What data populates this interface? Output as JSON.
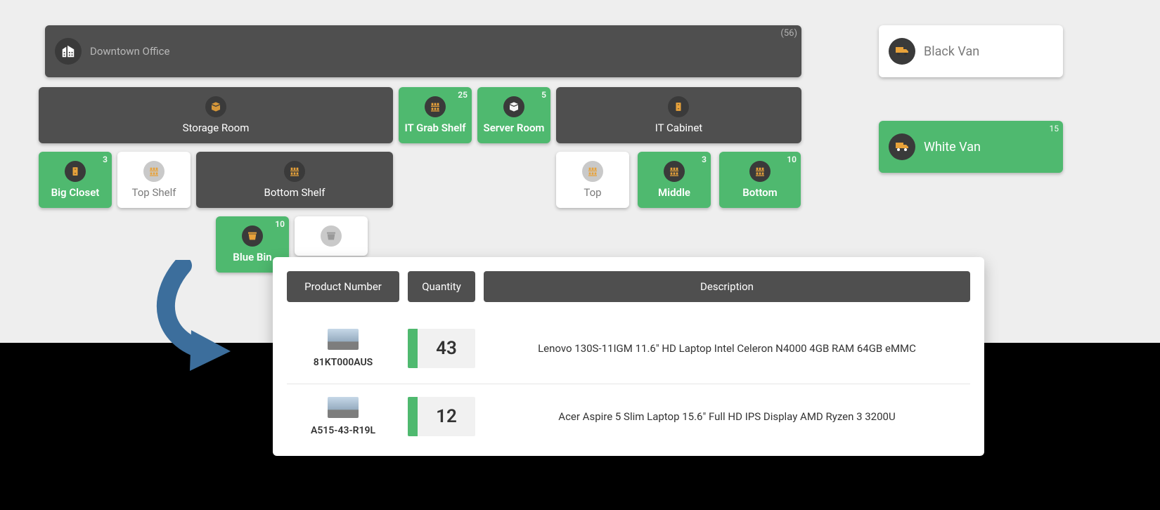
{
  "root_location": {
    "name": "Downtown Office",
    "count": "(56)"
  },
  "vehicles": {
    "black_van": {
      "name": "Black Van"
    },
    "white_van": {
      "name": "White Van",
      "count": "15"
    }
  },
  "rooms": {
    "storage_room": {
      "name": "Storage Room"
    },
    "it_grab_shelf": {
      "name": "IT Grab Shelf",
      "count": "25"
    },
    "server_room": {
      "name": "Server Room",
      "count": "5"
    },
    "it_cabinet": {
      "name": "IT Cabinet"
    }
  },
  "shelves": {
    "big_closet": {
      "name": "Big Closet",
      "count": "3"
    },
    "top_shelf": {
      "name": "Top Shelf"
    },
    "bottom_shelf": {
      "name": "Bottom Shelf"
    },
    "top": {
      "name": "Top"
    },
    "middle": {
      "name": "Middle",
      "count": "3"
    },
    "bottom": {
      "name": "Bottom",
      "count": "10"
    }
  },
  "bins": {
    "blue_bin": {
      "name": "Blue Bin",
      "count": "10"
    }
  },
  "table": {
    "columns": {
      "product_number": "Product Number",
      "quantity": "Quantity",
      "description": "Description"
    },
    "rows": [
      {
        "product_number": "81KT000AUS",
        "quantity": "43",
        "description": "Lenovo 130S-11IGM 11.6\" HD Laptop Intel Celeron N4000 4GB RAM 64GB eMMC"
      },
      {
        "product_number": "A515-43-R19L",
        "quantity": "12",
        "description": "Acer Aspire 5 Slim Laptop 15.6\" Full HD IPS Display AMD Ryzen 3 3200U"
      }
    ]
  }
}
